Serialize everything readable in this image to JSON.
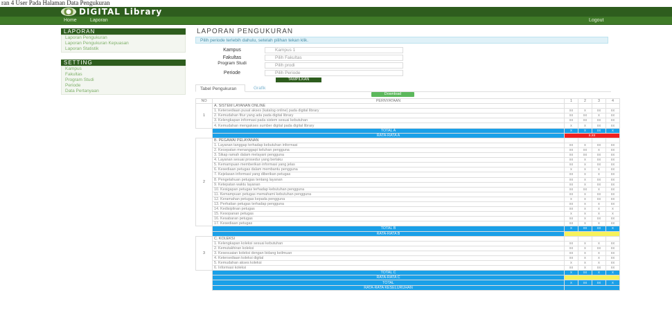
{
  "caption": "ran 4 User Pada Halaman Data Pengukuran",
  "app": {
    "title": "DIGITAL Library"
  },
  "nav": {
    "home": "Home",
    "laporan": "Laporan",
    "logout": "Logout"
  },
  "sidebar": {
    "laporan_heading": "LAPORAN",
    "laporan_items": [
      "Laporan Pengukuran",
      "Laporan Pengukuran Kepuasan",
      "Laporan Statistik"
    ],
    "setting_heading": "SETTING",
    "setting_items": [
      "Kampus",
      "Fakultas",
      "Program Studi",
      "Periode",
      "Data Pertanyaan"
    ]
  },
  "main": {
    "title": "LAPORAN PENGUKURAN",
    "alert": "Pilih periode terlebih dahulu, setelah pilihan tekan klik.",
    "form": {
      "kampus": {
        "label": "Kampus",
        "value": "Kampus 1"
      },
      "fakultas": {
        "label": "Fakultas",
        "value": "Pilih Fakultas"
      },
      "prodi": {
        "label": "Program Studi",
        "value": "Pilih prodi"
      },
      "periode": {
        "label": "Periode",
        "value": "Pilih Periode"
      },
      "submit": "TAMPILKAN"
    },
    "tabs": [
      "Tabel Pengukuran",
      "Grafik"
    ],
    "export": "Download"
  },
  "table": {
    "headers": [
      "NO",
      "PERNYATAAN",
      "1",
      "2",
      "3",
      "4"
    ],
    "sections": [
      {
        "no": "1",
        "heading": "A. SISTEM LAYANAN ONLINE",
        "rows": [
          {
            "text": "1. Ketersediaan pusat akses (katalog online) pada digital library",
            "values": [
              "xx",
              "x",
              "xx",
              "xx"
            ]
          },
          {
            "text": "2. Kemudahan fitur yang ada pada digital library",
            "values": [
              "xx",
              "xx",
              "x",
              "xx"
            ]
          },
          {
            "text": "3. Kelengkapan informasi pada sistem sesuai kebutuhan",
            "values": [
              "xx",
              "xx",
              "xx",
              "xx"
            ]
          },
          {
            "text": "4. Kemudahan mengakses sumber digital pada digital library",
            "values": [
              "x",
              "x",
              "xx",
              "xx"
            ]
          }
        ],
        "total_label": "TOTAL A",
        "total_values": [
          "x",
          "x",
          "xx",
          "x"
        ],
        "avg_label": "RATA-RATA A",
        "avg_value": "x.xx"
      },
      {
        "no": "2",
        "heading": "B. PEGAWAI PELAYANAN",
        "rows": [
          {
            "text": "1. Layanan tanggap terhadap kebutuhan informasi",
            "values": [
              "xx",
              "x",
              "xx",
              "xx"
            ]
          },
          {
            "text": "2. Kecepatan menanggapi keluhan pengguna",
            "values": [
              "xx",
              "xx",
              "x",
              "xx"
            ]
          },
          {
            "text": "3. Sikap ramah dalam melayani pengguna",
            "values": [
              "xx",
              "xx",
              "xx",
              "xx"
            ]
          },
          {
            "text": "4. Layanan sesuai prosedur yang berlaku",
            "values": [
              "xx",
              "x",
              "xx",
              "xx"
            ]
          },
          {
            "text": "5. Kemampuan memberikan informasi yang jelas",
            "values": [
              "xx",
              "x",
              "xx",
              "xx"
            ]
          },
          {
            "text": "6. Kesediaan petugas dalam membantu pengguna",
            "values": [
              "x",
              "x",
              "x",
              "xx"
            ]
          },
          {
            "text": "7. Kejelasan informasi yang diberikan petugas",
            "values": [
              "xx",
              "x",
              "x",
              "xx"
            ]
          },
          {
            "text": "8. Pengetahuan petugas tentang layanan",
            "values": [
              "xx",
              "x",
              "xx",
              "xx"
            ]
          },
          {
            "text": "9. Ketepatan waktu layanan",
            "values": [
              "xx",
              "x",
              "xx",
              "xx"
            ]
          },
          {
            "text": "10. Kesigapan petugas terhadap kebutuhan pengguna",
            "values": [
              "xx",
              "xx",
              "x",
              "xx"
            ]
          },
          {
            "text": "11. Kemampuan petugas memahami kebutuhan pengguna",
            "values": [
              "xx",
              "x",
              "xx",
              "xx"
            ]
          },
          {
            "text": "12. Keramahan petugas kepada pengguna",
            "values": [
              "x",
              "x",
              "xx",
              "xx"
            ]
          },
          {
            "text": "13. Perhatian petugas terhadap pengguna",
            "values": [
              "xx",
              "x",
              "x",
              "xx"
            ]
          },
          {
            "text": "14. Kedisiplinan petugas",
            "values": [
              "xx",
              "x",
              "x",
              "x"
            ]
          },
          {
            "text": "15. Kesopanan petugas",
            "values": [
              "x",
              "x",
              "x",
              "x"
            ]
          },
          {
            "text": "16. Kesabaran petugas",
            "values": [
              "xx",
              "x",
              "xx",
              "xx"
            ]
          },
          {
            "text": "17. Kesediaan petugas",
            "values": [
              "xx",
              "x",
              "x",
              "xx"
            ]
          }
        ],
        "total_label": "TOTAL B",
        "total_values": [
          "x",
          "xx",
          "xx",
          "x"
        ],
        "avg_label": "RATA-RATA B",
        "avg_value": ""
      },
      {
        "no": "3",
        "heading": "C. KOLEKSI",
        "rows": [
          {
            "text": "1. Kelengkapan koleksi sesuai kebutuhan",
            "values": [
              "xx",
              "x",
              "x",
              "xx"
            ]
          },
          {
            "text": "2. Kemutakhiran koleksi",
            "values": [
              "xx",
              "x",
              "xx",
              "xx"
            ]
          },
          {
            "text": "3. Kesesuaian koleksi dengan bidang keilmuan",
            "values": [
              "xx",
              "x",
              "x",
              "xx"
            ]
          },
          {
            "text": "4. Ketersediaan koleksi digital",
            "values": [
              "xx",
              "x",
              "x",
              "xx"
            ]
          },
          {
            "text": "5. Kemudahan akses koleksi",
            "values": [
              "x",
              "x",
              "x",
              "xx"
            ]
          },
          {
            "text": "6. Informasi koleksi",
            "values": [
              "xx",
              "x",
              "xx",
              "xx"
            ]
          }
        ],
        "total_label": "TOTAL C",
        "total_values": [
          "x",
          "xx",
          "x",
          "x"
        ],
        "avg_label": "RATA-RATA C",
        "avg_value": ""
      }
    ],
    "grand_total_label": "TOTAL",
    "grand_total_values": [
      "x",
      "xx",
      "xx",
      "x"
    ],
    "grand_avg_label": "RATA-RATA KESELURUHAN",
    "grand_avg_value": ""
  }
}
